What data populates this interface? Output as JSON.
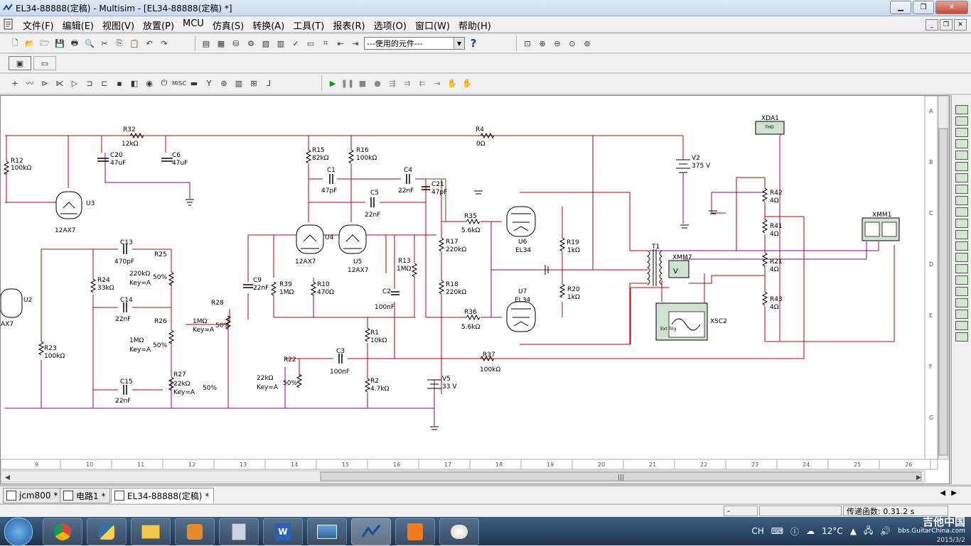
{
  "window": {
    "title": "EL34-88888(定稿) - Multisim - [EL34-88888(定稿) *]"
  },
  "menu": [
    "文件(F)",
    "编辑(E)",
    "视图(V)",
    "放置(P)",
    "MCU",
    "仿真(S)",
    "转换(A)",
    "工具(T)",
    "报表(R)",
    "选项(O)",
    "窗口(W)",
    "帮助(H)"
  ],
  "toolbar": {
    "component_combo": "---使用的元件---",
    "help_label": "?"
  },
  "ruler": {
    "columns": [
      "9",
      "10",
      "11",
      "12",
      "13",
      "14",
      "15",
      "16",
      "17",
      "18",
      "19",
      "20",
      "21",
      "22",
      "23",
      "24",
      "25",
      "26"
    ],
    "rows": [
      "A",
      "B",
      "C",
      "D",
      "E",
      "F",
      "G"
    ]
  },
  "schematic": {
    "labels": [
      {
        "t": "R12"
      },
      {
        "t": "100kΩ"
      },
      {
        "t": "R32"
      },
      {
        "t": "12kΩ"
      },
      {
        "t": "C20"
      },
      {
        "t": "47uF"
      },
      {
        "t": "C6"
      },
      {
        "t": "47uF"
      },
      {
        "t": "U3"
      },
      {
        "t": "12AX7"
      },
      {
        "t": "U2"
      },
      {
        "t": "AX7"
      },
      {
        "t": "C13"
      },
      {
        "t": "470pF"
      },
      {
        "t": "R25"
      },
      {
        "t": "220kΩ"
      },
      {
        "t": "Key=A"
      },
      {
        "t": "50%"
      },
      {
        "t": "R24"
      },
      {
        "t": "33kΩ"
      },
      {
        "t": "C14"
      },
      {
        "t": "22nF"
      },
      {
        "t": "R26"
      },
      {
        "t": "1MΩ"
      },
      {
        "t": "Key=A"
      },
      {
        "t": "1MΩ"
      },
      {
        "t": "Key=A"
      },
      {
        "t": "50%"
      },
      {
        "t": "R28"
      },
      {
        "t": "50%"
      },
      {
        "t": "R23"
      },
      {
        "t": "100kΩ"
      },
      {
        "t": "C15"
      },
      {
        "t": "22nF"
      },
      {
        "t": "R27"
      },
      {
        "t": "22kΩ"
      },
      {
        "t": "Key=A"
      },
      {
        "t": "50%"
      },
      {
        "t": "R15"
      },
      {
        "t": "82kΩ"
      },
      {
        "t": "R16"
      },
      {
        "t": "100kΩ"
      },
      {
        "t": "C1"
      },
      {
        "t": "47pF"
      },
      {
        "t": "C4"
      },
      {
        "t": "22nF"
      },
      {
        "t": "C5"
      },
      {
        "t": "22nF"
      },
      {
        "t": "C21"
      },
      {
        "t": "47pF"
      },
      {
        "t": "U4"
      },
      {
        "t": "12AX7"
      },
      {
        "t": "U5"
      },
      {
        "t": "12AX7"
      },
      {
        "t": "C9"
      },
      {
        "t": "22nF"
      },
      {
        "t": "R39"
      },
      {
        "t": "1MΩ"
      },
      {
        "t": "R10"
      },
      {
        "t": "470Ω"
      },
      {
        "t": "R13"
      },
      {
        "t": "1MΩ"
      },
      {
        "t": "C2"
      },
      {
        "t": "100nF"
      },
      {
        "t": "R1"
      },
      {
        "t": "10kΩ"
      },
      {
        "t": "R22"
      },
      {
        "t": "22kΩ"
      },
      {
        "t": "Key=A"
      },
      {
        "t": "50%"
      },
      {
        "t": "C3"
      },
      {
        "t": "100nF"
      },
      {
        "t": "R2"
      },
      {
        "t": "4.7kΩ"
      },
      {
        "t": "V5"
      },
      {
        "t": "33 V"
      },
      {
        "t": "R4"
      },
      {
        "t": "0Ω"
      },
      {
        "t": "R35"
      },
      {
        "t": "5.6kΩ"
      },
      {
        "t": "R17"
      },
      {
        "t": "220kΩ"
      },
      {
        "t": "R18"
      },
      {
        "t": "220kΩ"
      },
      {
        "t": "R36"
      },
      {
        "t": "5.6kΩ"
      },
      {
        "t": "R37"
      },
      {
        "t": "100kΩ"
      },
      {
        "t": "U6"
      },
      {
        "t": "EL34"
      },
      {
        "t": "U7"
      },
      {
        "t": "EL34"
      },
      {
        "t": "R19"
      },
      {
        "t": "1kΩ"
      },
      {
        "t": "R20"
      },
      {
        "t": "1kΩ"
      },
      {
        "t": "V2"
      },
      {
        "t": "375 V"
      },
      {
        "t": "T1"
      },
      {
        "t": "XMM7"
      },
      {
        "t": "XSC2"
      },
      {
        "t": "XDA1"
      },
      {
        "t": "R42"
      },
      {
        "t": "4Ω"
      },
      {
        "t": "R41"
      },
      {
        "t": "4Ω"
      },
      {
        "t": "R21"
      },
      {
        "t": "4Ω"
      },
      {
        "t": "R43"
      },
      {
        "t": "4Ω"
      },
      {
        "t": "XMM1"
      },
      {
        "t": "THD"
      },
      {
        "t": "Ext Trig"
      }
    ]
  },
  "tabs": [
    {
      "label": "jcm800 *"
    },
    {
      "label": "电路1 *"
    },
    {
      "label": "EL34-88888(定稿) *"
    }
  ],
  "status": {
    "left": "-",
    "right": "传递函数: 0.31.2 s"
  },
  "taskbar": {
    "lang": "CH",
    "temp": "12°C",
    "date": "2015/3/2",
    "watermark_cn": "吉他中国",
    "watermark_url": "bbs.GuitarChina.com"
  },
  "colors": {
    "wire_red": "#c00000",
    "wire_purple": "#8b008b",
    "wire_green": "#008000"
  }
}
